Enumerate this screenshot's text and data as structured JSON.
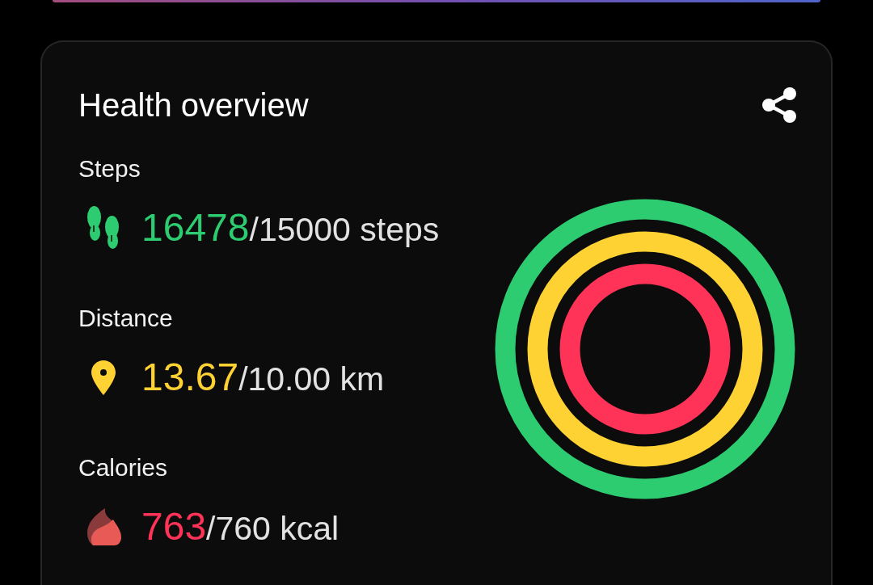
{
  "card": {
    "title": "Health overview",
    "metrics": [
      {
        "kind": "steps",
        "label": "Steps",
        "value": "16478",
        "goal": "/15000 steps",
        "color": "#2ecc71"
      },
      {
        "kind": "distance",
        "label": "Distance",
        "value": "13.67",
        "goal": "/10.00 km",
        "color": "#ffd233"
      },
      {
        "kind": "calories",
        "label": "Calories",
        "value": "763",
        "goal": "/760 kcal",
        "color": "#ff3358"
      }
    ],
    "rings": [
      {
        "color": "#2ecc71",
        "level": 1
      },
      {
        "color": "#ffd233",
        "level": 1
      },
      {
        "color": "#ff3358",
        "level": 1
      }
    ]
  }
}
